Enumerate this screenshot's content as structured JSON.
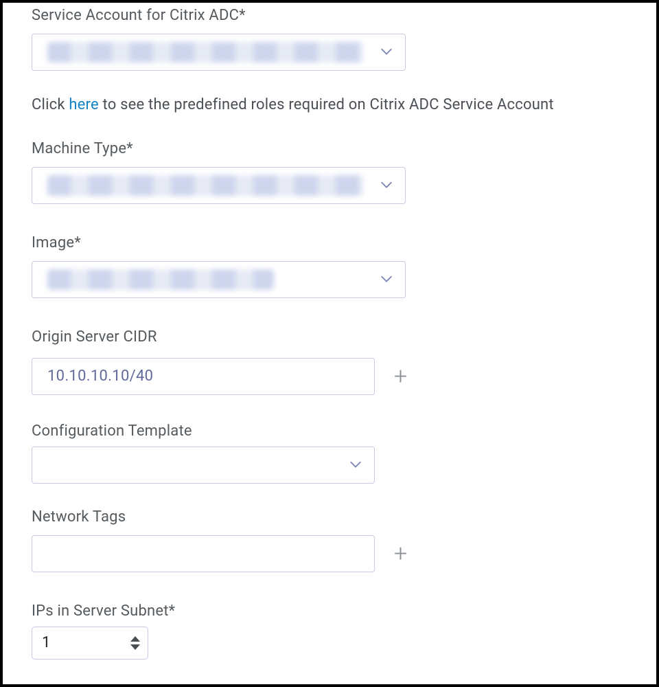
{
  "fields": {
    "serviceAccount": {
      "label": "Service Account for Citrix ADC*"
    },
    "helper": {
      "prefix": "Click ",
      "link": "here",
      "suffix": " to see the predefined roles required on Citrix ADC Service Account"
    },
    "machineType": {
      "label": "Machine Type*"
    },
    "image": {
      "label": "Image*"
    },
    "originCidr": {
      "label": "Origin Server CIDR",
      "value": "10.10.10.10/40"
    },
    "configTemplate": {
      "label": "Configuration Template"
    },
    "networkTags": {
      "label": "Network Tags",
      "value": ""
    },
    "ipsInSubnet": {
      "label": "IPs in Server Subnet*",
      "value": "1"
    }
  },
  "icons": {
    "plus": "+"
  }
}
